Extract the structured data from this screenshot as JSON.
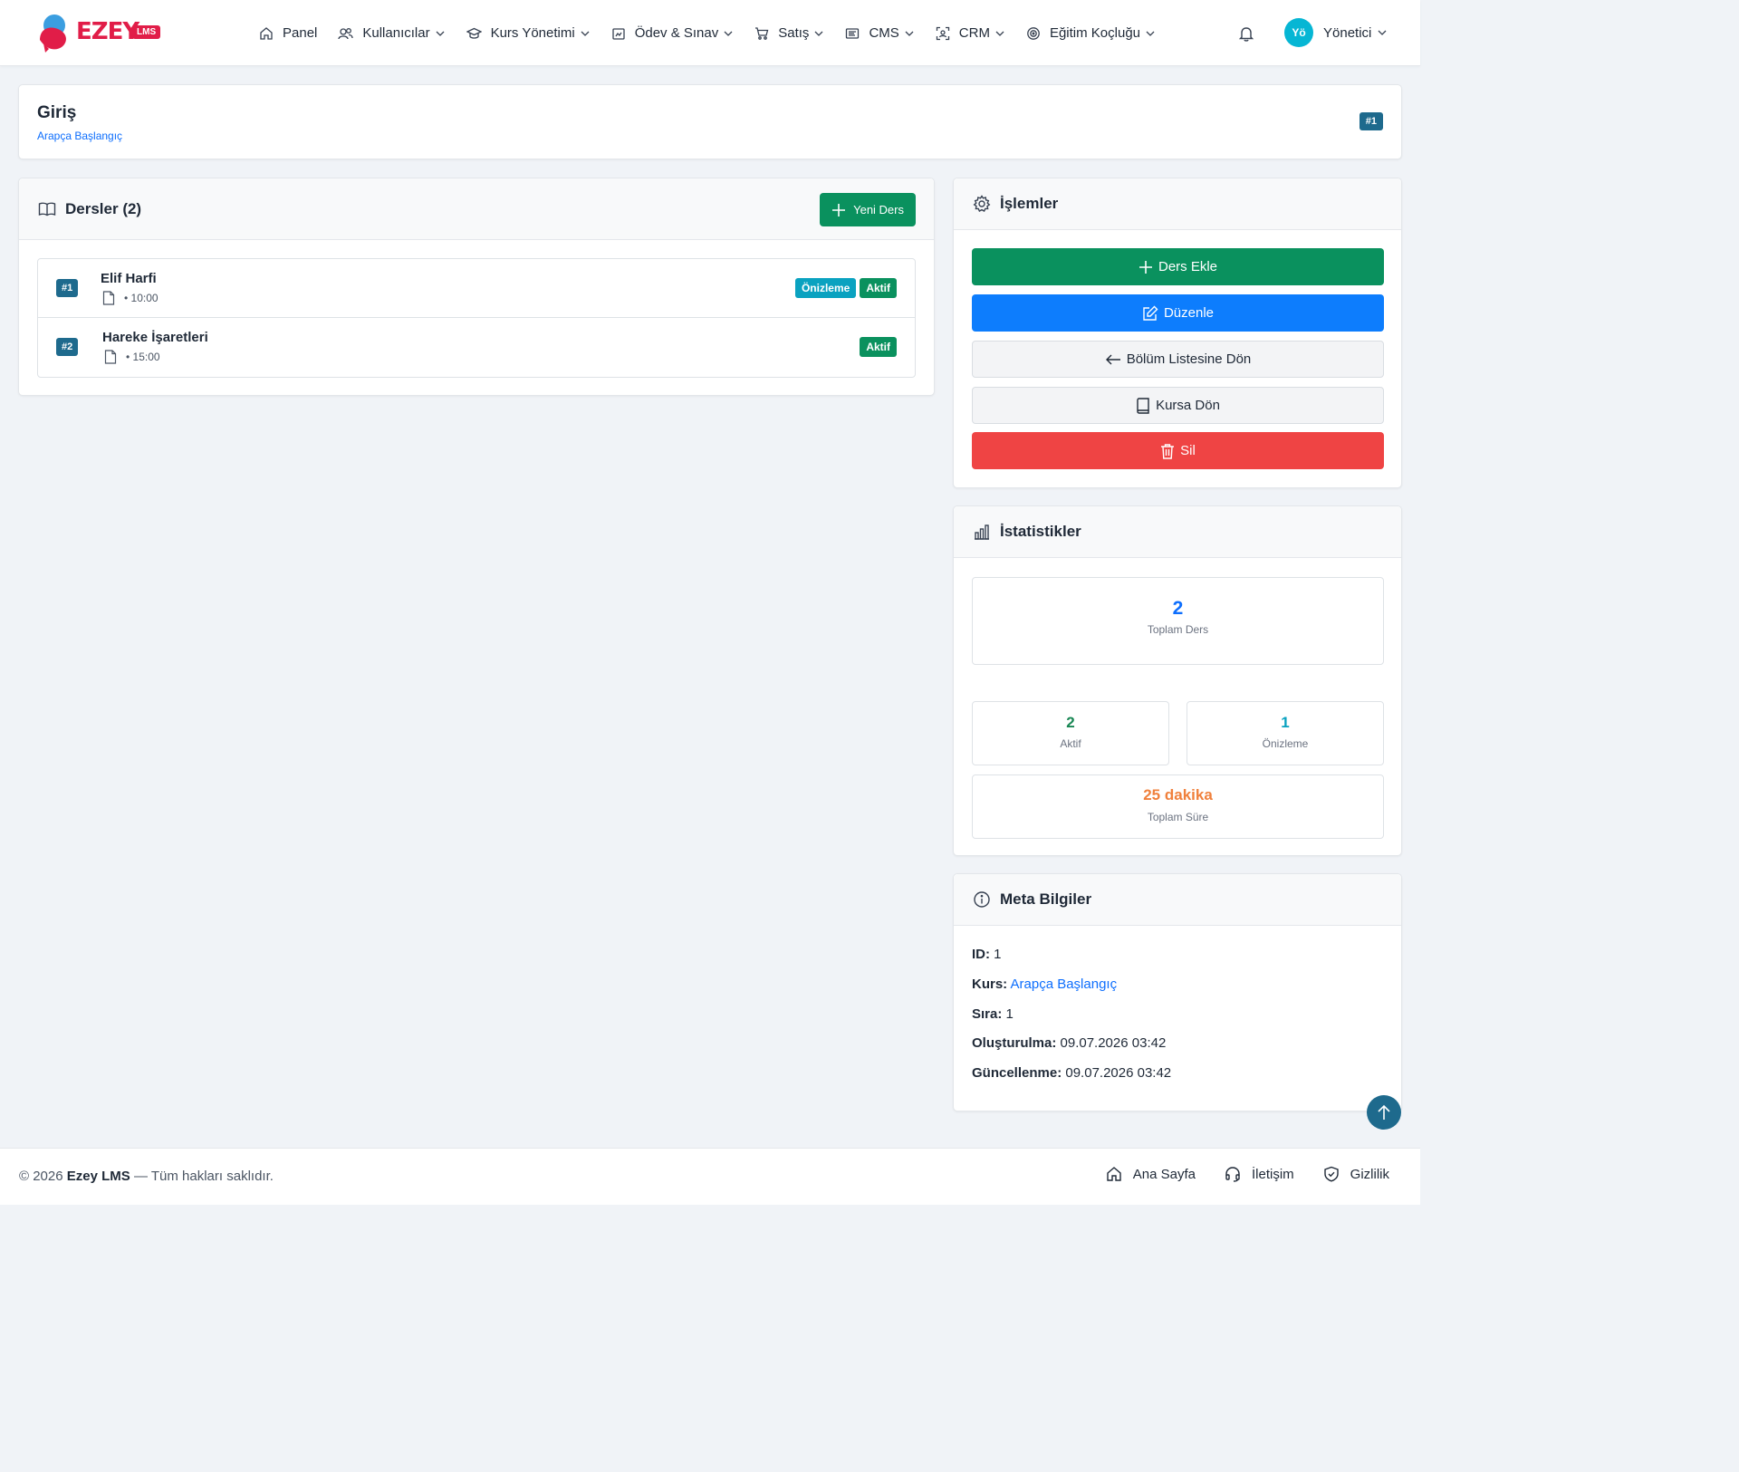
{
  "brand": {
    "name": "EZEY",
    "badge": "LMS",
    "primary": "#e11d48",
    "accent": "#1e6a8d"
  },
  "nav": {
    "items": [
      {
        "label": "Panel",
        "icon": "home-icon",
        "dropdown": false
      },
      {
        "label": "Kullanıcılar",
        "icon": "users-icon",
        "dropdown": true
      },
      {
        "label": "Kurs Yönetimi",
        "icon": "graduation-cap-icon",
        "dropdown": true
      },
      {
        "label": "Ödev & Sınav",
        "icon": "clipboard-icon",
        "dropdown": true
      },
      {
        "label": "Satış",
        "icon": "cart-icon",
        "dropdown": true
      },
      {
        "label": "CMS",
        "icon": "cms-icon",
        "dropdown": true
      },
      {
        "label": "CRM",
        "icon": "crm-icon",
        "dropdown": true
      },
      {
        "label": "Eğitim Koçluğu",
        "icon": "target-icon",
        "dropdown": true
      }
    ],
    "user": {
      "initials": "Yö",
      "name": "Yönetici"
    }
  },
  "page": {
    "title": "Giriş",
    "course": "Arapça Başlangıç",
    "id_badge": "#1"
  },
  "lessons": {
    "title": "Dersler (2)",
    "new_button": "Yeni Ders",
    "items": [
      {
        "num": "#1",
        "title": "Elif Harfi",
        "duration": "• 10:00",
        "tags": [
          "Önizleme",
          "Aktif"
        ]
      },
      {
        "num": "#2",
        "title": "Hareke İşaretleri",
        "duration": "• 15:00",
        "tags": [
          "Aktif"
        ]
      }
    ]
  },
  "actions": {
    "title": "İşlemler",
    "add": "Ders Ekle",
    "edit": "Düzenle",
    "back_sections": "Bölüm Listesine Dön",
    "back_course": "Kursa Dön",
    "delete": "Sil"
  },
  "stats": {
    "title": "İstatistikler",
    "total": {
      "value": "2",
      "label": "Toplam Ders",
      "color": "#0d6efd"
    },
    "active": {
      "value": "2",
      "label": "Aktif",
      "color": "#198754"
    },
    "preview": {
      "value": "1",
      "label": "Önizleme",
      "color": "#0aa2c0"
    },
    "duration": {
      "value": "25 dakika",
      "label": "Toplam Süre",
      "color": "#f0803c"
    }
  },
  "meta": {
    "title": "Meta Bilgiler",
    "id_label": "ID:",
    "id": "1",
    "course_label": "Kurs:",
    "course": "Arapça Başlangıç",
    "order_label": "Sıra:",
    "order": "1",
    "created_label": "Oluşturulma:",
    "created": "09.07.2026 03:42",
    "updated_label": "Güncellenme:",
    "updated": "09.07.2026 03:42"
  },
  "footer": {
    "copy_prefix": "© 2026",
    "copy_brand": "Ezey LMS",
    "copy_suffix": "— Tüm hakları saklıdır.",
    "links": [
      "Ana Sayfa",
      "İletişim",
      "Gizlilik"
    ]
  }
}
